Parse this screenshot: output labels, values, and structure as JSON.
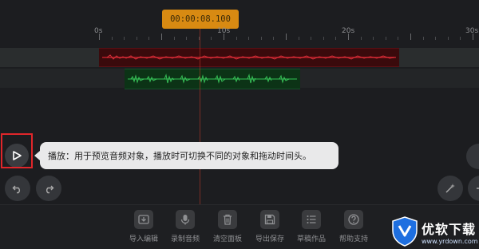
{
  "timecode": "00:00:08.100",
  "ruler": {
    "labels": [
      "0s",
      "10s",
      "20s",
      "30s"
    ]
  },
  "tooltip": {
    "text": "播放：用于预览音频对象，播放时可切换不同的对象和拖动时间头。"
  },
  "toolbar": {
    "items": [
      {
        "label": "导入编辑",
        "icon": "import-icon"
      },
      {
        "label": "录制音频",
        "icon": "microphone-icon"
      },
      {
        "label": "清空面板",
        "icon": "trash-icon"
      },
      {
        "label": "导出保存",
        "icon": "save-icon"
      },
      {
        "label": "草稿作品",
        "icon": "list-icon"
      },
      {
        "label": "帮助支持",
        "icon": "help-icon"
      }
    ]
  },
  "watermark": {
    "title": "优软下载",
    "url": "www.yrdown.com"
  },
  "colors": {
    "timecode_bg": "#d88a12",
    "clip_red": "#3a0a0c",
    "waveform_red": "#c0202a",
    "clip_green": "#0c3316",
    "waveform_green": "#2aa848",
    "highlight": "#e0262a"
  }
}
